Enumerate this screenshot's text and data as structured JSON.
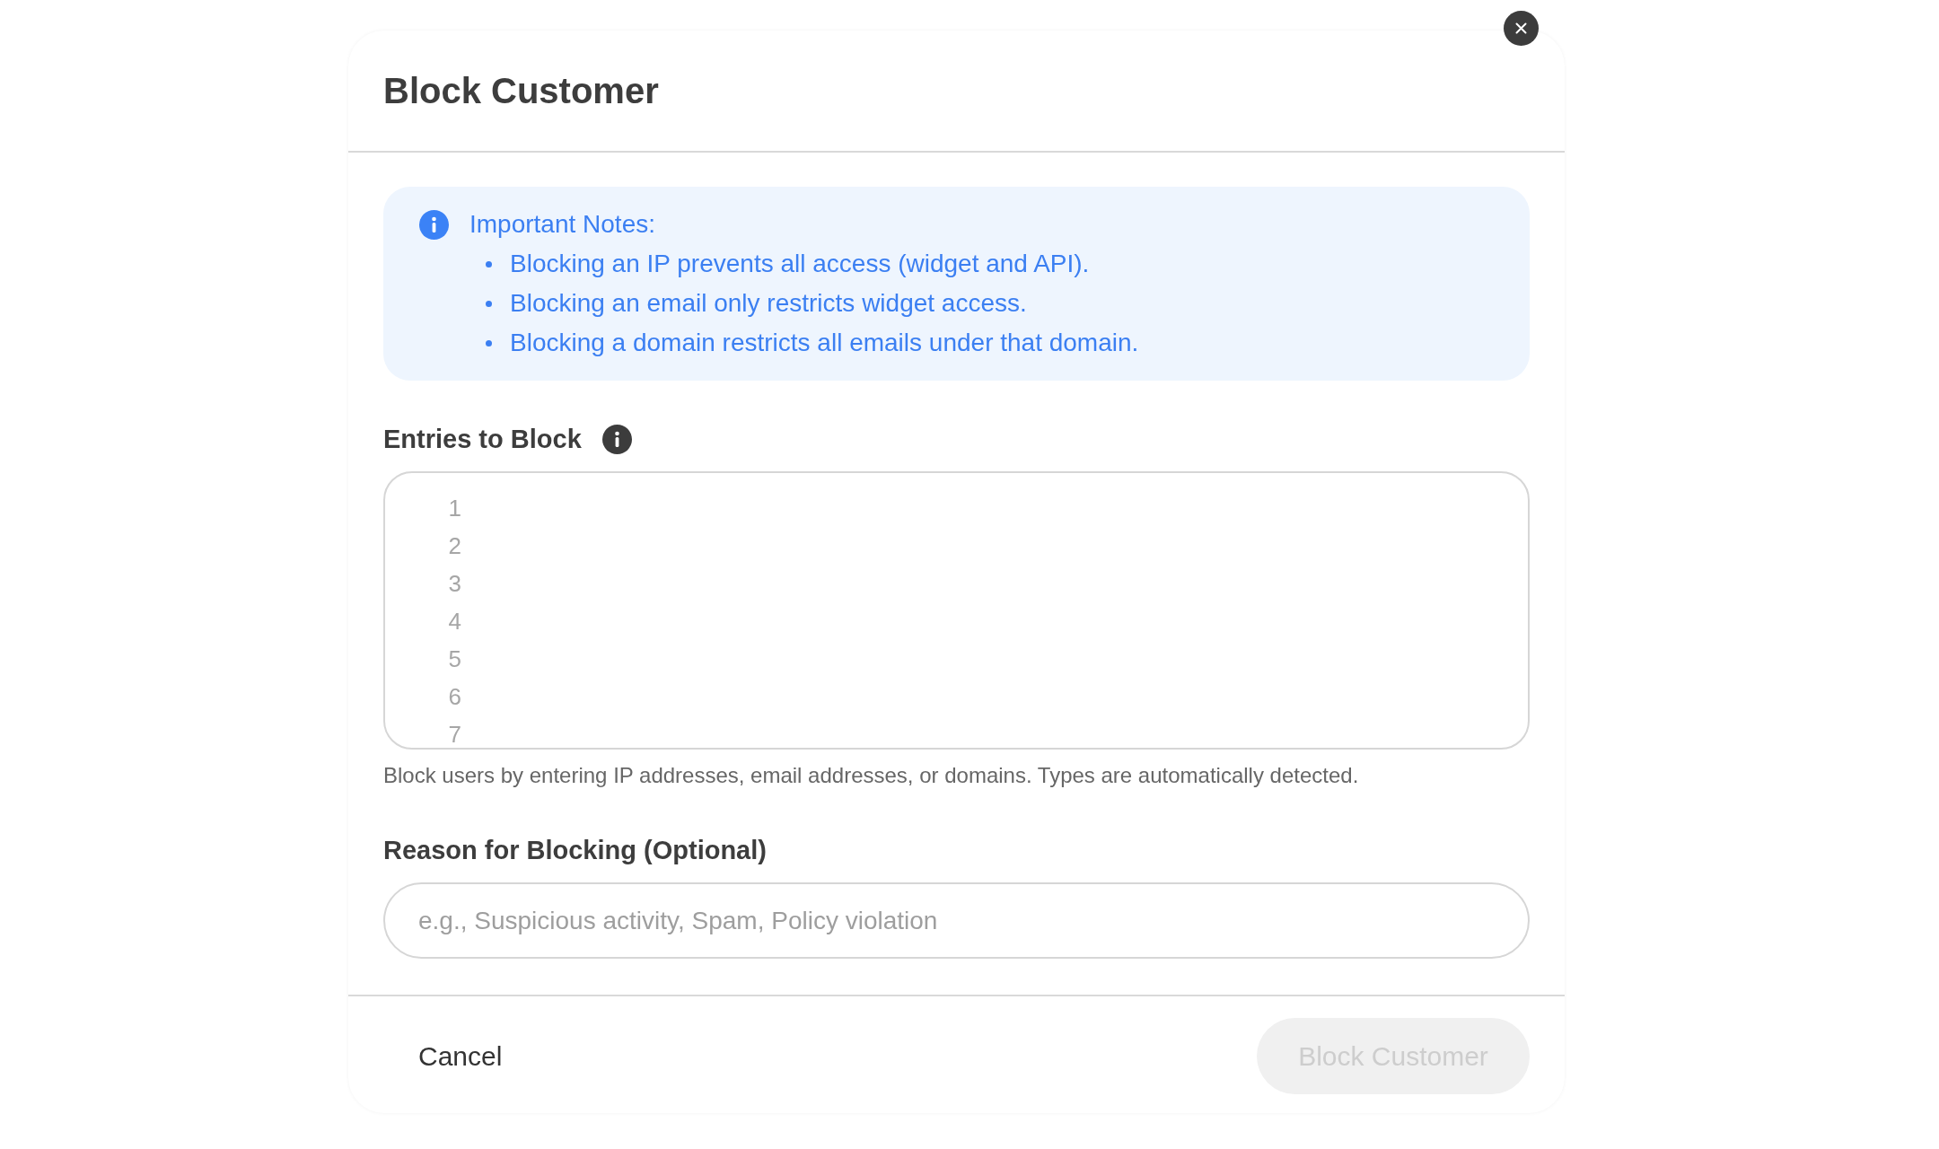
{
  "dialog": {
    "title": "Block Customer"
  },
  "notes": {
    "title": "Important Notes:",
    "items": [
      "Blocking an IP prevents all access (widget and API).",
      "Blocking an email only restricts widget access.",
      "Blocking a domain restricts all emails under that domain."
    ]
  },
  "entries": {
    "label": "Entries to Block",
    "line_numbers": [
      "1",
      "2",
      "3",
      "4",
      "5",
      "6",
      "7"
    ],
    "help_text": "Block users by entering IP addresses, email addresses, or domains. Types are automatically detected."
  },
  "reason": {
    "label": "Reason for Blocking (Optional)",
    "placeholder": "e.g., Suspicious activity, Spam, Policy violation"
  },
  "footer": {
    "buttons": [
      {
        "label": "Cancel",
        "kind": "text",
        "disabled": false
      },
      {
        "label": "Block Customer",
        "kind": "primary",
        "disabled": true
      }
    ]
  }
}
